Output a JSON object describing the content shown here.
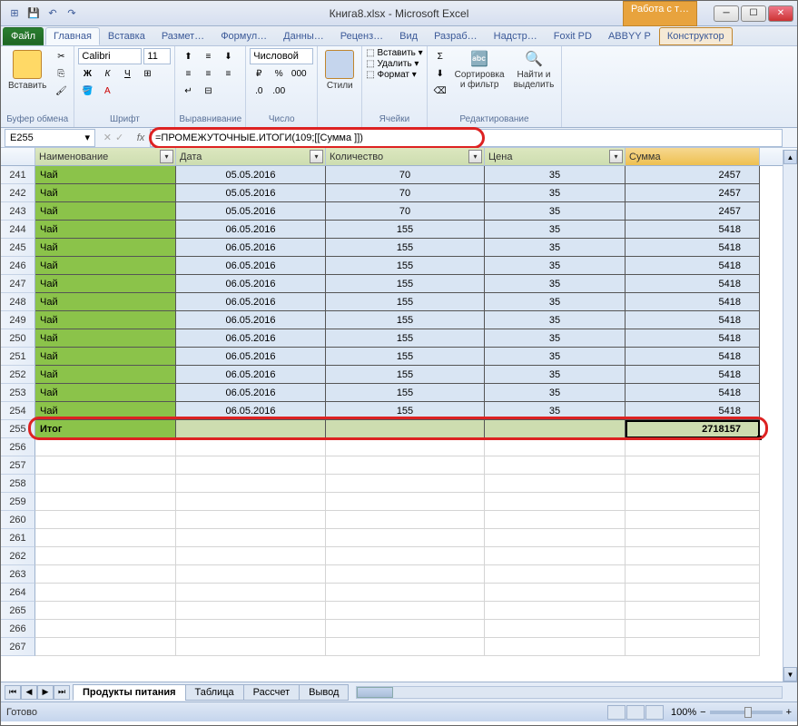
{
  "title": "Книга8.xlsx - Microsoft Excel",
  "table_tools": "Работа с т…",
  "tabs": {
    "file": "Файл",
    "home": "Главная",
    "insert": "Вставка",
    "layout": "Размет…",
    "formulas": "Формул…",
    "data": "Данны…",
    "review": "Реценз…",
    "view": "Вид",
    "dev": "Разраб…",
    "addins": "Надстр…",
    "foxit": "Foxit PD",
    "abbyy": "ABBYY P",
    "design": "Конструктор"
  },
  "ribbon": {
    "clipboard": {
      "paste": "Вставить",
      "label": "Буфер обмена"
    },
    "font": {
      "name": "Calibri",
      "size": "11",
      "label": "Шрифт"
    },
    "align": {
      "label": "Выравнивание"
    },
    "number": {
      "format": "Числовой",
      "label": "Число"
    },
    "styles": {
      "btn": "Стили",
      "label": ""
    },
    "cells": {
      "insert": "Вставить",
      "delete": "Удалить",
      "format": "Формат",
      "label": "Ячейки"
    },
    "editing": {
      "sort": "Сортировка\nи фильтр",
      "find": "Найти и\nвыделить",
      "label": "Редактирование"
    }
  },
  "name_box": "E255",
  "formula": "=ПРОМЕЖУТОЧНЫЕ.ИТОГИ(109;[[Сумма ]])",
  "headers": [
    "Наименование",
    "Дата",
    "Количество",
    "Цена",
    "Сумма"
  ],
  "rows": [
    {
      "n": 241,
      "name": "Чай",
      "date": "05.05.2016",
      "qty": 70,
      "price": 35,
      "sum": 2457
    },
    {
      "n": 242,
      "name": "Чай",
      "date": "05.05.2016",
      "qty": 70,
      "price": 35,
      "sum": 2457
    },
    {
      "n": 243,
      "name": "Чай",
      "date": "05.05.2016",
      "qty": 70,
      "price": 35,
      "sum": 2457
    },
    {
      "n": 244,
      "name": "Чай",
      "date": "06.05.2016",
      "qty": 155,
      "price": 35,
      "sum": 5418
    },
    {
      "n": 245,
      "name": "Чай",
      "date": "06.05.2016",
      "qty": 155,
      "price": 35,
      "sum": 5418
    },
    {
      "n": 246,
      "name": "Чай",
      "date": "06.05.2016",
      "qty": 155,
      "price": 35,
      "sum": 5418
    },
    {
      "n": 247,
      "name": "Чай",
      "date": "06.05.2016",
      "qty": 155,
      "price": 35,
      "sum": 5418
    },
    {
      "n": 248,
      "name": "Чай",
      "date": "06.05.2016",
      "qty": 155,
      "price": 35,
      "sum": 5418
    },
    {
      "n": 249,
      "name": "Чай",
      "date": "06.05.2016",
      "qty": 155,
      "price": 35,
      "sum": 5418
    },
    {
      "n": 250,
      "name": "Чай",
      "date": "06.05.2016",
      "qty": 155,
      "price": 35,
      "sum": 5418
    },
    {
      "n": 251,
      "name": "Чай",
      "date": "06.05.2016",
      "qty": 155,
      "price": 35,
      "sum": 5418
    },
    {
      "n": 252,
      "name": "Чай",
      "date": "06.05.2016",
      "qty": 155,
      "price": 35,
      "sum": 5418
    },
    {
      "n": 253,
      "name": "Чай",
      "date": "06.05.2016",
      "qty": 155,
      "price": 35,
      "sum": 5418
    },
    {
      "n": 254,
      "name": "Чай",
      "date": "06.05.2016",
      "qty": 155,
      "price": 35,
      "sum": 5418
    }
  ],
  "total_row": {
    "n": 255,
    "name": "Итог",
    "sum": 2718157
  },
  "empty_rows": [
    256,
    257,
    258,
    259,
    260,
    261,
    262,
    263,
    264,
    265,
    266,
    267
  ],
  "sheets": [
    "Продукты питания",
    "Таблица",
    "Рассчет",
    "Вывод"
  ],
  "status": "Готово",
  "zoom": "100%"
}
